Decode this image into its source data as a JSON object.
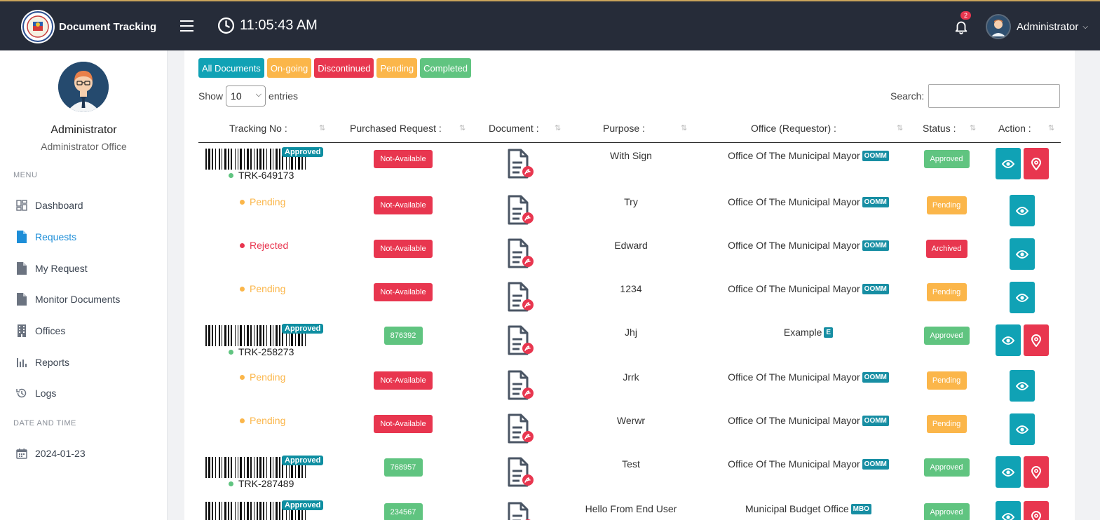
{
  "app": {
    "title": "Document Tracking",
    "time": "11:05:43 AM",
    "notif_count": "2",
    "user": "Administrator"
  },
  "sidebar": {
    "name": "Administrator",
    "office": "Administrator Office",
    "menu_heading": "MENU",
    "items": [
      {
        "label": "Dashboard",
        "icon": "dashboard-icon"
      },
      {
        "label": "Requests",
        "icon": "document-icon",
        "active": true
      },
      {
        "label": "My Request",
        "icon": "document-icon"
      },
      {
        "label": "Monitor Documents",
        "icon": "document-icon"
      },
      {
        "label": "Offices",
        "icon": "building-icon"
      },
      {
        "label": "Reports",
        "icon": "bar-chart-icon"
      },
      {
        "label": "Logs",
        "icon": "history-icon"
      }
    ],
    "date_heading": "DATE AND TIME",
    "date": "2024-01-23"
  },
  "filters": [
    "All Documents",
    "On-going",
    "Discontinued",
    "Pending",
    "Completed"
  ],
  "filter_colors": [
    "#10a2b5",
    "#fbb64a",
    "#e8364f",
    "#fbb64a",
    "#60c480"
  ],
  "table": {
    "show_label": "Show",
    "entries_value": "10",
    "entries_label": "entries",
    "search_label": "Search:",
    "headers": [
      "Tracking No :",
      "Purchased Request :",
      "Document :",
      "Purpose :",
      "Office (Requestor) :",
      "Status :",
      "Action :"
    ],
    "rows": [
      {
        "tracking": "TRK-649173",
        "tracking_state": "approved",
        "approved_label": "Approved",
        "pr": "Not-Available",
        "pr_color": "red",
        "purpose": "With Sign",
        "office": "Office Of The Municipal Mayor",
        "office_tag": "OOMM",
        "status": "Approved",
        "status_color": "green",
        "map_action": true
      },
      {
        "tracking": "Pending",
        "tracking_state": "pending",
        "pr": "Not-Available",
        "pr_color": "red",
        "purpose": "Try",
        "office": "Office Of The Municipal Mayor",
        "office_tag": "OOMM",
        "status": "Pending",
        "status_color": "orange",
        "map_action": false
      },
      {
        "tracking": "Rejected",
        "tracking_state": "rejected",
        "pr": "Not-Available",
        "pr_color": "red",
        "purpose": "Edward",
        "office": "Office Of The Municipal Mayor",
        "office_tag": "OOMM",
        "status": "Archived",
        "status_color": "red",
        "map_action": false
      },
      {
        "tracking": "Pending",
        "tracking_state": "pending",
        "pr": "Not-Available",
        "pr_color": "red",
        "purpose": "1234",
        "office": "Office Of The Municipal Mayor",
        "office_tag": "OOMM",
        "status": "Pending",
        "status_color": "orange",
        "map_action": false
      },
      {
        "tracking": "TRK-258273",
        "tracking_state": "approved",
        "approved_label": "Approved",
        "pr": "876392",
        "pr_color": "green",
        "purpose": "Jhj",
        "office": "Example",
        "office_tag": "E",
        "status": "Approved",
        "status_color": "green",
        "map_action": true
      },
      {
        "tracking": "Pending",
        "tracking_state": "pending",
        "pr": "Not-Available",
        "pr_color": "red",
        "purpose": "Jrrk",
        "office": "Office Of The Municipal Mayor",
        "office_tag": "OOMM",
        "status": "Pending",
        "status_color": "orange",
        "map_action": false
      },
      {
        "tracking": "Pending",
        "tracking_state": "pending",
        "pr": "Not-Available",
        "pr_color": "red",
        "purpose": "Werwr",
        "office": "Office Of The Municipal Mayor",
        "office_tag": "OOMM",
        "status": "Pending",
        "status_color": "orange",
        "map_action": false
      },
      {
        "tracking": "TRK-287489",
        "tracking_state": "approved",
        "approved_label": "Approved",
        "pr": "768957",
        "pr_color": "green",
        "purpose": "Test",
        "office": "Office Of The Municipal Mayor",
        "office_tag": "OOMM",
        "status": "Approved",
        "status_color": "green",
        "map_action": true
      },
      {
        "tracking": "",
        "tracking_state": "approved",
        "approved_label": "Approved",
        "pr": "234567",
        "pr_color": "green",
        "purpose": "Hello From End User",
        "office": "Municipal Budget Office",
        "office_tag": "MBO",
        "status": "Approved",
        "status_color": "green",
        "map_action": true
      }
    ]
  }
}
